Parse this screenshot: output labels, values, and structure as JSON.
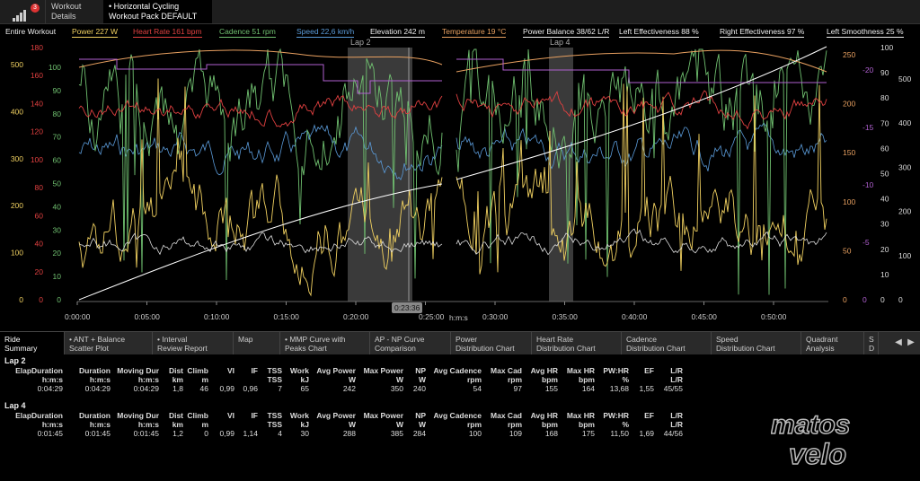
{
  "topbar": {
    "badge": "3",
    "tab_details_line1": "Workout",
    "tab_details_line2": "Details",
    "tab_active_line1": "• Horizontal Cycling",
    "tab_active_line2": "Workout Pack DEFAULT"
  },
  "chart": {
    "range_label": "Entire Workout",
    "metrics": [
      {
        "label": "Power  227 W",
        "color": "#f0d060"
      },
      {
        "label": "Heart Rate  161 bpm",
        "color": "#e04040"
      },
      {
        "label": "Cadence  51 rpm",
        "color": "#70c070"
      },
      {
        "label": "Speed  22,6 km/h",
        "color": "#5a9ad8"
      },
      {
        "label": "Elevation  242 m",
        "color": "#eeeeee"
      },
      {
        "label": "Temperature  19 °C",
        "color": "#e8a060"
      },
      {
        "label": "Power Balance  38/62 L/R",
        "color": "#eeeeee"
      },
      {
        "label": "Left Effectiveness  88 %",
        "color": "#eeeeee"
      },
      {
        "label": "Right Effectiveness  97 %",
        "color": "#eeeeee"
      },
      {
        "label": "Left Smoothness  25 %",
        "color": "#eeeeee"
      }
    ],
    "lap_labels": [
      "Lap 2",
      "Lap 4"
    ],
    "time_ticks": [
      "0:00:00",
      "0:05:00",
      "0:10:00",
      "0:15:00",
      "0:20:00",
      "0:25:00",
      "0:30:00",
      "0:35:00",
      "0:40:00",
      "0:45:00",
      "0:50:00"
    ],
    "cursor_time": "0:23:36",
    "time_axis_unit": "h:m:s",
    "axis_left_power": [
      "500",
      "400",
      "300",
      "200",
      "100",
      "0"
    ],
    "axis_left_hr": [
      "180",
      "160",
      "140",
      "120",
      "100",
      "80",
      "60",
      "40",
      "20",
      "0"
    ],
    "axis_left_cad": [
      "100",
      "90",
      "80",
      "70",
      "60",
      "50",
      "40",
      "30",
      "20",
      "10",
      "0"
    ],
    "axis_right_a": [
      "250",
      "200",
      "150",
      "100",
      "50",
      "0"
    ],
    "axis_right_b": [
      "-20",
      "-15",
      "-10",
      "-5",
      "0"
    ],
    "axis_right_c": [
      "100",
      "90",
      "80",
      "70",
      "60",
      "50",
      "40",
      "30",
      "20",
      "10",
      "0"
    ],
    "axis_right_d": [
      "500",
      "400",
      "300",
      "200",
      "100",
      "0"
    ],
    "colors": {
      "power": "#f0d060",
      "hr": "#e04040",
      "cadence": "#70c070",
      "speed": "#5a9ad8",
      "elevation": "#ffffff",
      "temp": "#e8a060",
      "purple": "#b060d0"
    }
  },
  "lower_tabs": [
    {
      "l1": "Ride",
      "l2": "Summary"
    },
    {
      "l1": "• ANT + Balance",
      "l2": "Scatter Plot"
    },
    {
      "l1": "• Interval",
      "l2": "Review Report"
    },
    {
      "l1": "Map",
      "l2": ""
    },
    {
      "l1": "• MMP Curve with",
      "l2": "Peaks Chart"
    },
    {
      "l1": "AP - NP Curve",
      "l2": "Comparison"
    },
    {
      "l1": "Power",
      "l2": "Distribution Chart"
    },
    {
      "l1": "Heart Rate",
      "l2": "Distribution Chart"
    },
    {
      "l1": "Cadence",
      "l2": "Distribution Chart"
    },
    {
      "l1": "Speed",
      "l2": "Distribution Chart"
    },
    {
      "l1": "Quadrant",
      "l2": "Analysis"
    },
    {
      "l1": "S",
      "l2": "D"
    }
  ],
  "table": {
    "columns": [
      {
        "h1": "ElapDuration",
        "h2": "h:m:s"
      },
      {
        "h1": "Duration",
        "h2": "h:m:s"
      },
      {
        "h1": "Moving Dur",
        "h2": "h:m:s"
      },
      {
        "h1": "Dist",
        "h2": "km"
      },
      {
        "h1": "Climb",
        "h2": "m"
      },
      {
        "h1": "VI",
        "h2": ""
      },
      {
        "h1": "IF",
        "h2": ""
      },
      {
        "h1": "TSS",
        "h2": "TSS"
      },
      {
        "h1": "Work",
        "h2": "kJ"
      },
      {
        "h1": "Avg Power",
        "h2": "W"
      },
      {
        "h1": "Max Power",
        "h2": "W"
      },
      {
        "h1": "NP",
        "h2": "W"
      },
      {
        "h1": "Avg Cadence",
        "h2": "rpm"
      },
      {
        "h1": "Max Cad",
        "h2": "rpm"
      },
      {
        "h1": "Avg HR",
        "h2": "bpm"
      },
      {
        "h1": "Max HR",
        "h2": "bpm"
      },
      {
        "h1": "PW:HR",
        "h2": "%"
      },
      {
        "h1": "EF",
        "h2": ""
      },
      {
        "h1": "L/R",
        "h2": "L/R"
      }
    ],
    "laps": [
      {
        "title": "Lap 2",
        "values": [
          "0:04:29",
          "0:04:29",
          "0:04:29",
          "1,8",
          "46",
          "0,99",
          "0,96",
          "7",
          "65",
          "242",
          "350",
          "240",
          "54",
          "97",
          "155",
          "164",
          "13,68",
          "1,55",
          "45/55"
        ]
      },
      {
        "title": "Lap 4",
        "values": [
          "0:01:45",
          "0:01:45",
          "0:01:45",
          "1,2",
          "0",
          "0,99",
          "1,14",
          "4",
          "30",
          "288",
          "385",
          "284",
          "100",
          "109",
          "168",
          "175",
          "11,50",
          "1,69",
          "44/56"
        ]
      }
    ]
  },
  "watermark": {
    "line1": "matos",
    "line2": "velo"
  }
}
